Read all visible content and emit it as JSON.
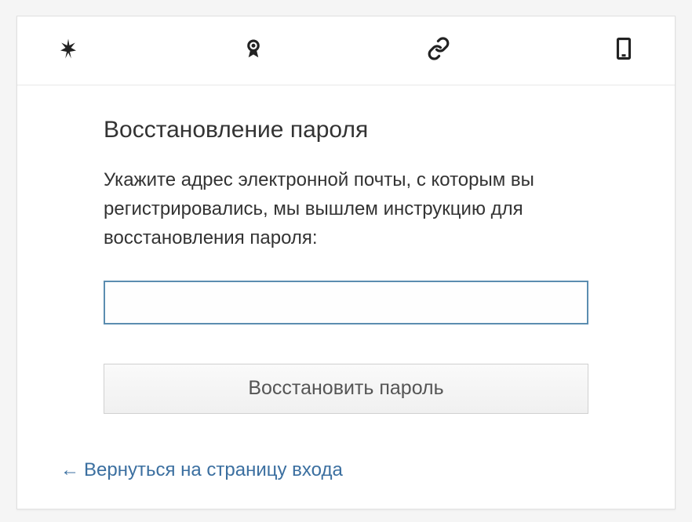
{
  "tabs": {
    "asterisk": "asterisk-icon",
    "badge": "badge-icon",
    "link": "link-icon",
    "phone": "phone-icon"
  },
  "form": {
    "heading": "Восстановление пароля",
    "description": "Укажите адрес электронной почты, с которым вы регистрировались, мы вышлем инструкцию для восстановления пароля:",
    "email_value": "",
    "submit_label": "Восстановить пароль"
  },
  "footer": {
    "back_arrow": "←",
    "back_label": "Вернуться на страницу входа"
  }
}
